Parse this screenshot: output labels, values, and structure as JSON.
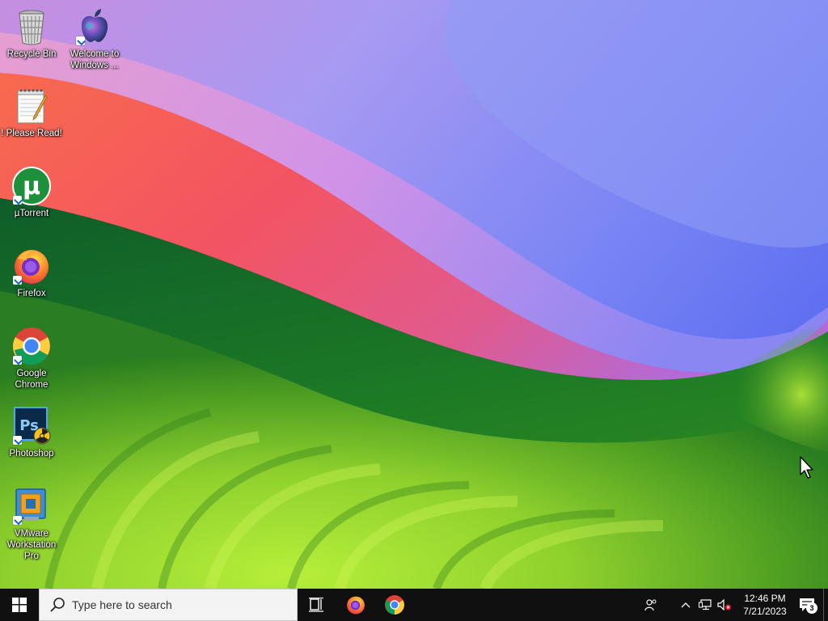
{
  "desktop": {
    "icons": [
      {
        "label": "Recycle Bin",
        "icon": "recycle-bin-icon"
      },
      {
        "label": "Welcome to\nWindows ...",
        "icon": "apple-icon"
      },
      {
        "label": "! Please Read!",
        "icon": "notepad-icon"
      },
      {
        "label": "µTorrent",
        "icon": "utorrent-icon"
      },
      {
        "label": "Firefox",
        "icon": "firefox-icon"
      },
      {
        "label": "Google\nChrome",
        "icon": "chrome-icon"
      },
      {
        "label": "Photoshop",
        "icon": "photoshop-icon"
      },
      {
        "label": "VMware\nWorkstation\nPro",
        "icon": "vmware-icon"
      }
    ]
  },
  "taskbar": {
    "search_placeholder": "Type here to search",
    "pinned": [
      "task-view-icon",
      "firefox-icon",
      "chrome-icon"
    ],
    "tray": [
      "people-icon",
      "chevron-up-icon",
      "network-icon",
      "volume-muted-icon"
    ],
    "clock_time": "12:46 PM",
    "clock_date": "7/21/2023",
    "notification_count": "3"
  },
  "colors": {
    "taskbar_bg": "#101010",
    "search_bg": "#f3f3f3",
    "wallpaper_green": "#6fb31f",
    "wallpaper_red": "#f2585a",
    "wallpaper_blue": "#6a6ef0"
  }
}
